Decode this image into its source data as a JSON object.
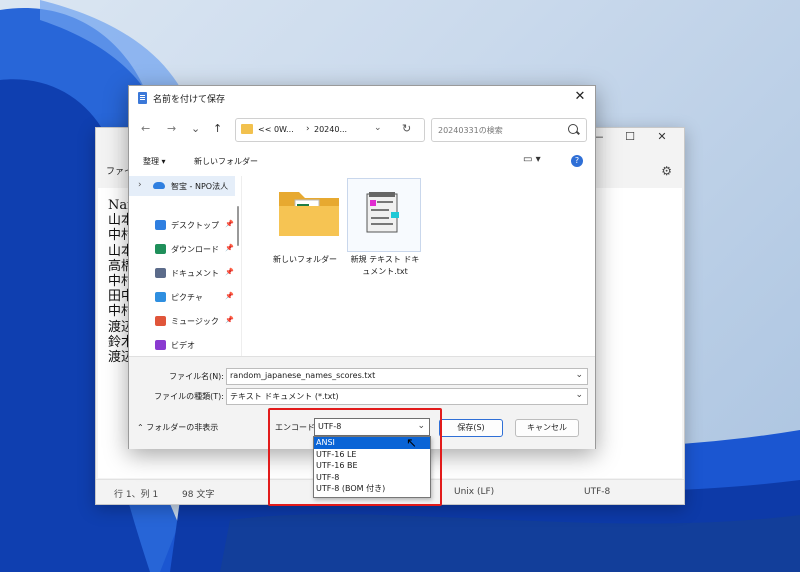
{
  "notepad": {
    "menu_label": "ファイル",
    "lines": [
      "Nam",
      "山本",
      "中村",
      "山本",
      "高橋",
      "中村",
      "田中",
      "中村",
      "渡辺",
      "鈴木",
      "渡辺"
    ],
    "status": {
      "position": "行 1、列 1",
      "chars": "98 文字",
      "line_ending": "Unix (LF)",
      "encoding": "UTF-8"
    }
  },
  "dialog": {
    "title": "名前を付けて保存",
    "address": {
      "part1": "<< 0W...",
      "part2": "20240..."
    },
    "search_placeholder": "20240331の検索",
    "commands": {
      "organize": "整理 ▾",
      "new_folder": "新しいフォルダー"
    },
    "sidebar": {
      "top": "智宝 - NPO法人",
      "items": [
        {
          "label": "デスクトップ",
          "color": "#2f7fe0"
        },
        {
          "label": "ダウンロード",
          "color": "#1f8f5a"
        },
        {
          "label": "ドキュメント",
          "color": "#5b6b8a"
        },
        {
          "label": "ピクチャ",
          "color": "#2f8fe0"
        },
        {
          "label": "ミュージック",
          "color": "#e0553a"
        },
        {
          "label": "ビデオ",
          "color": "#8a3ad0"
        }
      ]
    },
    "files": [
      {
        "label": "新しいフォルダー"
      },
      {
        "label": "新規 テキスト ドキュメント.txt"
      }
    ],
    "filename_label": "ファイル名(N):",
    "filename_value": "random_japanese_names_scores.txt",
    "filetype_label": "ファイルの種類(T):",
    "filetype_value": "テキスト ドキュメント (*.txt)",
    "hide_folders": "フォルダーの非表示",
    "encoding_label": "エンコード:",
    "encoding_value": "UTF-8",
    "save_button": "保存(S)",
    "cancel_button": "キャンセル",
    "encoding_options": [
      "ANSI",
      "UTF-16 LE",
      "UTF-16 BE",
      "UTF-8",
      "UTF-8 (BOM 付き)"
    ],
    "selected_option": "ANSI"
  },
  "colors": {
    "accent": "#0a64d6",
    "highlight": "#e21b1b",
    "folder": "#f2c14e"
  }
}
